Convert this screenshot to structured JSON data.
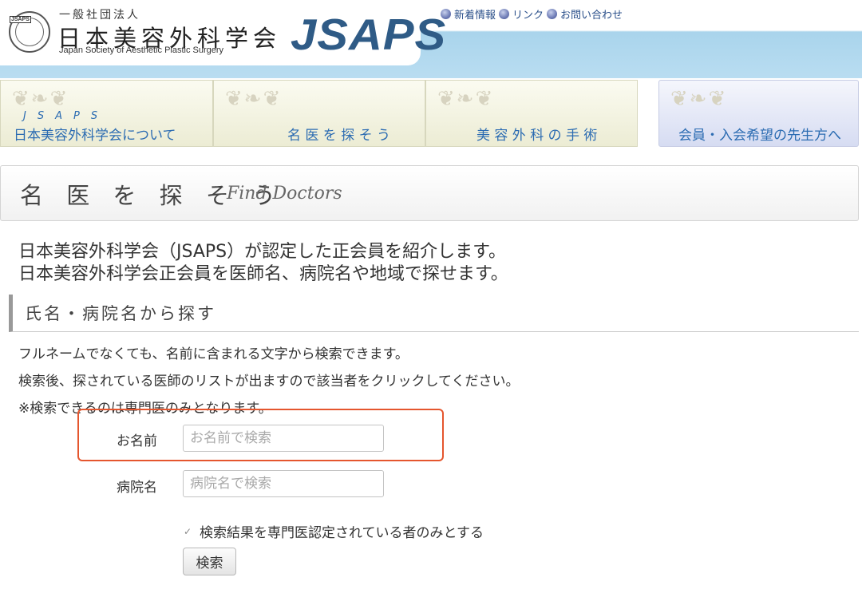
{
  "header": {
    "org_small": "一般社団法人",
    "org_name": "日本美容外科学会",
    "org_english": "Japan Society of Aesthetic Plastic Surgery",
    "seal_text": "JSAPS",
    "brand": "JSAPS",
    "links": [
      "新着情報",
      "リンク",
      "お問い合わせ"
    ]
  },
  "nav": {
    "about_sub": "JSAPS",
    "about": "日本美容外科学会について",
    "find": "名 医 を 探 そ う",
    "surgery": "美 容 外 科 の 手 術",
    "member": "会員・入会希望の先生方へ"
  },
  "page": {
    "title_jp": "名 医 を 探 そ う",
    "title_en": "Find Doctors",
    "intro_1": "日本美容外科学会（JSAPS）が認定した正会員を紹介します。",
    "intro_2": "日本美容外科学会正会員を医師名、病院名や地域で探せます。"
  },
  "search": {
    "heading": "氏名・病院名から探す",
    "desc_1": "フルネームでなくても、名前に含まれる文字から検索できます。",
    "desc_2": "検索後、探されている医師のリストが出ますので該当者をクリックしてください。",
    "desc_3": "※検索できるのは専門医のみとなります。",
    "name_label": "お名前",
    "name_placeholder": "お名前で検索",
    "hospital_label": "病院名",
    "hospital_placeholder": "病院名で検索",
    "checkbox_label": "検索結果を専門医認定されている者のみとする",
    "checkbox_checked": true,
    "button_label": "検索"
  },
  "colors": {
    "brand": "#2f5b86",
    "nav_text": "#2c6cb2",
    "highlight": "#e5562e"
  }
}
